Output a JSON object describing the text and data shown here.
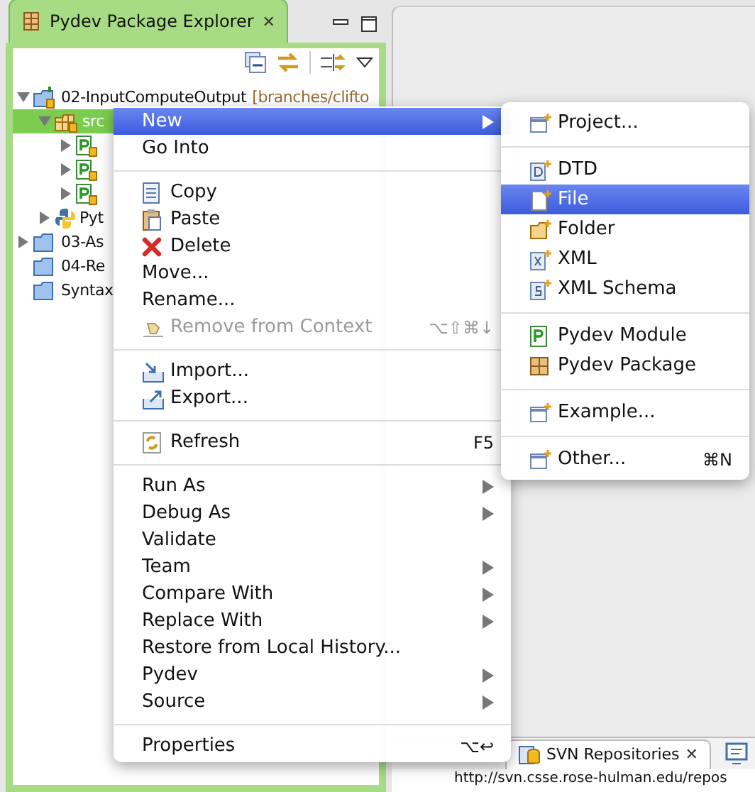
{
  "explorer": {
    "title": "Pydev Package Explorer",
    "close": "✕"
  },
  "tree": [
    {
      "label": "02-InputComputeOutput",
      "decoration": "[branches/clifto",
      "expanded": true,
      "kind": "project",
      "children": [
        {
          "label": "src",
          "kind": "package",
          "expanded": true,
          "selected": true,
          "children": [
            {
              "kind": "module",
              "expanded": false
            },
            {
              "kind": "module",
              "expanded": false
            },
            {
              "kind": "module",
              "expanded": false
            }
          ]
        },
        {
          "label": "Pyt",
          "kind": "python",
          "expanded": false
        }
      ]
    },
    {
      "label": "03-As",
      "kind": "folder",
      "expanded": false
    },
    {
      "label": "04-Re",
      "kind": "folder"
    },
    {
      "label": "Syntax",
      "kind": "folder"
    }
  ],
  "menu": [
    {
      "kind": "item",
      "label": "New",
      "submenu": true,
      "selected": true,
      "disabled": false
    },
    {
      "kind": "item",
      "label": "Go Into",
      "submenu": false,
      "selected": false,
      "disabled": false
    },
    {
      "kind": "separator"
    },
    {
      "kind": "item",
      "label": "Copy",
      "submenu": false,
      "selected": false,
      "disabled": false
    },
    {
      "kind": "item",
      "label": "Paste",
      "submenu": false,
      "selected": false,
      "disabled": false
    },
    {
      "kind": "item",
      "label": "Delete",
      "submenu": false,
      "selected": false,
      "disabled": false
    },
    {
      "kind": "item",
      "label": "Move...",
      "submenu": false,
      "selected": false,
      "disabled": false
    },
    {
      "kind": "item",
      "label": "Rename...",
      "submenu": false,
      "selected": false,
      "disabled": false
    },
    {
      "kind": "item",
      "label": "Remove from Context",
      "shortcut": "⌥⇧⌘↓",
      "submenu": false,
      "selected": false,
      "disabled": true
    },
    {
      "kind": "separator"
    },
    {
      "kind": "item",
      "label": "Import...",
      "submenu": false,
      "selected": false,
      "disabled": false
    },
    {
      "kind": "item",
      "label": "Export...",
      "submenu": false,
      "selected": false,
      "disabled": false
    },
    {
      "kind": "separator"
    },
    {
      "kind": "item",
      "label": "Refresh",
      "shortcut": "F5",
      "submenu": false,
      "selected": false,
      "disabled": false
    },
    {
      "kind": "separator"
    },
    {
      "kind": "item",
      "label": "Run As",
      "submenu": true,
      "selected": false,
      "disabled": false
    },
    {
      "kind": "item",
      "label": "Debug As",
      "submenu": true,
      "selected": false,
      "disabled": false
    },
    {
      "kind": "item",
      "label": "Validate",
      "submenu": false,
      "selected": false,
      "disabled": false
    },
    {
      "kind": "item",
      "label": "Team",
      "submenu": true,
      "selected": false,
      "disabled": false
    },
    {
      "kind": "item",
      "label": "Compare With",
      "submenu": true,
      "selected": false,
      "disabled": false
    },
    {
      "kind": "item",
      "label": "Replace With",
      "submenu": true,
      "selected": false,
      "disabled": false
    },
    {
      "kind": "item",
      "label": "Restore from Local History...",
      "submenu": false,
      "selected": false,
      "disabled": false
    },
    {
      "kind": "item",
      "label": "Pydev",
      "submenu": true,
      "selected": false,
      "disabled": false
    },
    {
      "kind": "item",
      "label": "Source",
      "submenu": true,
      "selected": false,
      "disabled": false
    },
    {
      "kind": "separator"
    },
    {
      "kind": "item",
      "label": "Properties",
      "shortcut": "⌥↩",
      "submenu": false,
      "selected": false,
      "disabled": false
    }
  ],
  "submenu": [
    {
      "kind": "item",
      "label": "Project...",
      "selected": false
    },
    {
      "kind": "separator"
    },
    {
      "kind": "item",
      "label": "DTD",
      "selected": false
    },
    {
      "kind": "item",
      "label": "File",
      "selected": true
    },
    {
      "kind": "item",
      "label": "Folder",
      "selected": false
    },
    {
      "kind": "item",
      "label": "XML",
      "selected": false
    },
    {
      "kind": "item",
      "label": "XML Schema",
      "selected": false
    },
    {
      "kind": "separator"
    },
    {
      "kind": "item",
      "label": "Pydev Module",
      "selected": false
    },
    {
      "kind": "item",
      "label": "Pydev Package",
      "selected": false
    },
    {
      "kind": "separator"
    },
    {
      "kind": "item",
      "label": "Example...",
      "selected": false
    },
    {
      "kind": "separator"
    },
    {
      "kind": "item",
      "label": "Other...",
      "shortcut": "⌘N",
      "selected": false
    }
  ],
  "bottom_panel": {
    "tab": "SVN Repositories",
    "close": "✕",
    "row": "http://svn.csse.rose-hulman.edu/repos"
  }
}
